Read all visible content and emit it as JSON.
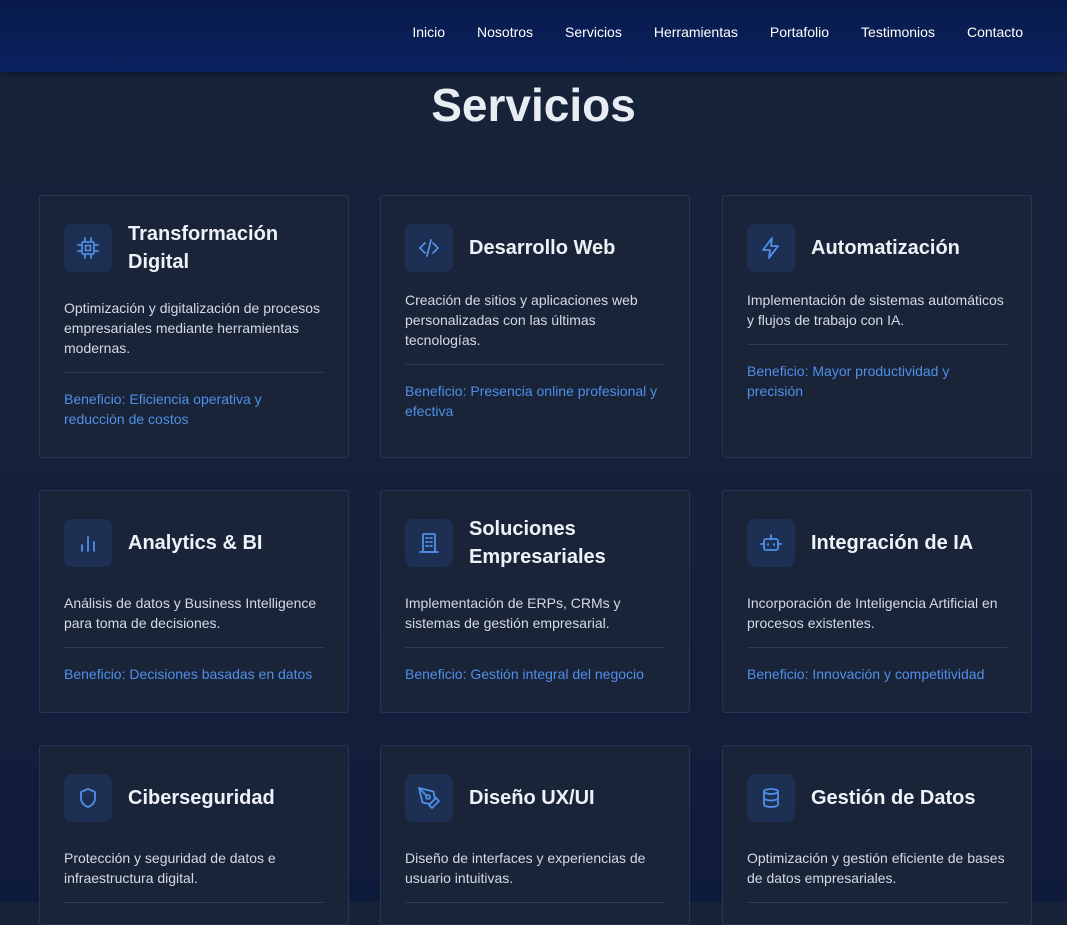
{
  "nav": {
    "logo": "",
    "links": [
      "Inicio",
      "Nosotros",
      "Servicios",
      "Herramientas",
      "Portafolio",
      "Testimonios",
      "Contacto"
    ]
  },
  "section": {
    "title": "Servicios"
  },
  "colors": {
    "accent": "#4f8fe8",
    "card_bg": "#1a2438",
    "nav_bg": "#0b2260"
  },
  "services": [
    {
      "icon": "cpu-icon",
      "title": "Transformación Digital",
      "description": "Optimización y digitalización de procesos empresariales mediante herramientas modernas.",
      "benefit": "Beneficio: Eficiencia operativa y reducción de costos"
    },
    {
      "icon": "code-icon",
      "title": "Desarrollo Web",
      "description": "Creación de sitios y aplicaciones web personalizadas con las últimas tecnologías.",
      "benefit": "Beneficio: Presencia online profesional y efectiva"
    },
    {
      "icon": "lightning-icon",
      "title": "Automatización",
      "description": "Implementación de sistemas automáticos y flujos de trabajo con IA.",
      "benefit": "Beneficio: Mayor productividad y precisión"
    },
    {
      "icon": "bar-chart-icon",
      "title": "Analytics & BI",
      "description": "Análisis de datos y Business Intelligence para toma de decisiones.",
      "benefit": "Beneficio: Decisiones basadas en datos"
    },
    {
      "icon": "building-icon",
      "title": "Soluciones Empresariales",
      "description": "Implementación de ERPs, CRMs y sistemas de gestión empresarial.",
      "benefit": "Beneficio: Gestión integral del negocio"
    },
    {
      "icon": "bot-icon",
      "title": "Integración de IA",
      "description": "Incorporación de Inteligencia Artificial en procesos existentes.",
      "benefit": "Beneficio: Innovación y competitividad"
    },
    {
      "icon": "shield-icon",
      "title": "Ciberseguridad",
      "description": "Protección y seguridad de datos e infraestructura digital.",
      "benefit": ""
    },
    {
      "icon": "pen-tool-icon",
      "title": "Diseño UX/UI",
      "description": "Diseño de interfaces y experiencias de usuario intuitivas.",
      "benefit": ""
    },
    {
      "icon": "database-icon",
      "title": "Gestión de Datos",
      "description": "Optimización y gestión eficiente de bases de datos empresariales.",
      "benefit": ""
    }
  ]
}
